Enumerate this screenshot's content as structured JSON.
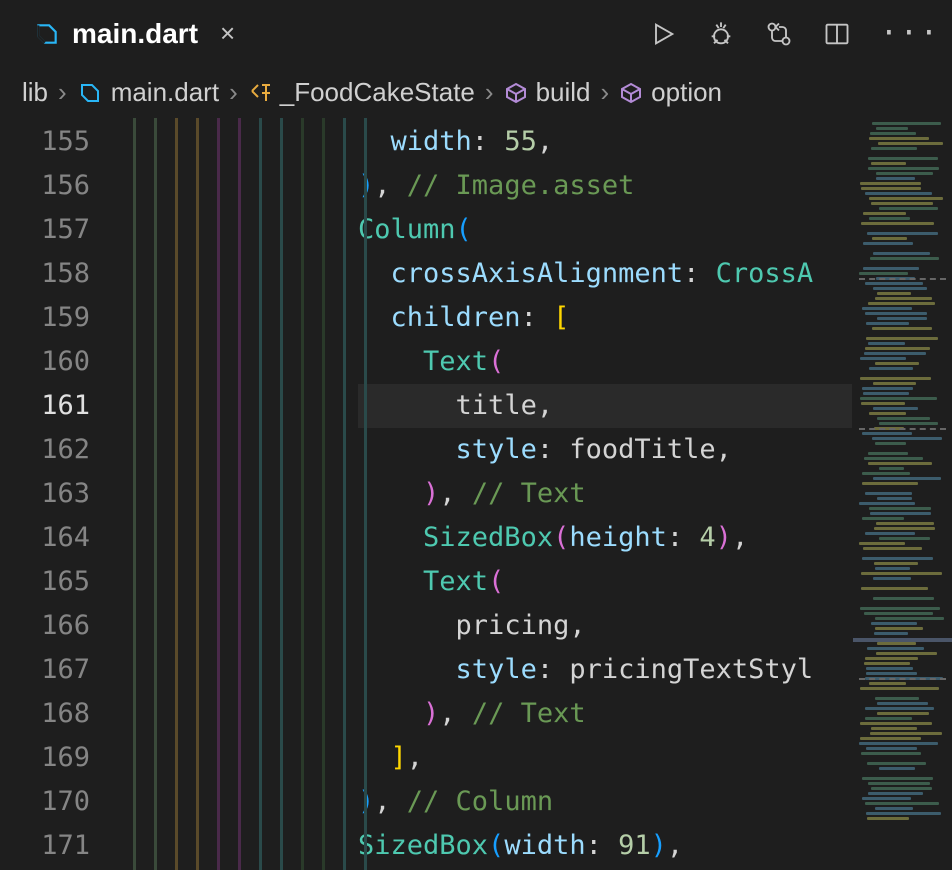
{
  "tab": {
    "filename": "main.dart",
    "close_glyph": "×"
  },
  "actions": {
    "run": "run-icon",
    "debug": "debug-icon",
    "git": "git-compare-icon",
    "split": "split-editor-icon",
    "more": "···"
  },
  "breadcrumbs": {
    "items": [
      {
        "label": "lib",
        "icon": null
      },
      {
        "label": "main.dart",
        "icon": "dart"
      },
      {
        "label": "_FoodCakeState",
        "icon": "class"
      },
      {
        "label": "build",
        "icon": "cube"
      },
      {
        "label": "option",
        "icon": "cube"
      }
    ],
    "separator": "›"
  },
  "gutter": {
    "start": 155,
    "active": 161,
    "lines": [
      155,
      156,
      157,
      158,
      159,
      160,
      161,
      162,
      163,
      164,
      165,
      166,
      167,
      168,
      169,
      170,
      171
    ]
  },
  "code": {
    "lines": [
      [
        {
          "t": "  ",
          "c": "plain"
        },
        {
          "t": "width",
          "c": "prop"
        },
        {
          "t": ": ",
          "c": "plain"
        },
        {
          "t": "55",
          "c": "num"
        },
        {
          "t": ",",
          "c": "plain"
        }
      ],
      [
        {
          "t": ")",
          "c": "paren3"
        },
        {
          "t": ", ",
          "c": "plain"
        },
        {
          "t": "// Image.asset",
          "c": "comment"
        }
      ],
      [
        {
          "t": "Column",
          "c": "kw-type"
        },
        {
          "t": "(",
          "c": "paren3"
        }
      ],
      [
        {
          "t": "  ",
          "c": "plain"
        },
        {
          "t": "crossAxisAlignment",
          "c": "prop"
        },
        {
          "t": ": ",
          "c": "plain"
        },
        {
          "t": "CrossA",
          "c": "kw-type"
        }
      ],
      [
        {
          "t": "  ",
          "c": "plain"
        },
        {
          "t": "children",
          "c": "prop"
        },
        {
          "t": ": ",
          "c": "plain"
        },
        {
          "t": "[",
          "c": "paren"
        }
      ],
      [
        {
          "t": "    ",
          "c": "plain"
        },
        {
          "t": "Text",
          "c": "kw-type"
        },
        {
          "t": "(",
          "c": "paren2"
        }
      ],
      [
        {
          "t": "      ",
          "c": "plain"
        },
        {
          "t": "title",
          "c": "ident"
        },
        {
          "t": ",",
          "c": "plain"
        }
      ],
      [
        {
          "t": "      ",
          "c": "plain"
        },
        {
          "t": "style",
          "c": "prop"
        },
        {
          "t": ": ",
          "c": "plain"
        },
        {
          "t": "foodTitle",
          "c": "ident"
        },
        {
          "t": ",",
          "c": "plain"
        }
      ],
      [
        {
          "t": "    ",
          "c": "plain"
        },
        {
          "t": ")",
          "c": "paren2"
        },
        {
          "t": ", ",
          "c": "plain"
        },
        {
          "t": "// Text",
          "c": "comment"
        }
      ],
      [
        {
          "t": "    ",
          "c": "plain"
        },
        {
          "t": "SizedBox",
          "c": "kw-type"
        },
        {
          "t": "(",
          "c": "paren2"
        },
        {
          "t": "height",
          "c": "prop"
        },
        {
          "t": ": ",
          "c": "plain"
        },
        {
          "t": "4",
          "c": "num"
        },
        {
          "t": ")",
          "c": "paren2"
        },
        {
          "t": ",",
          "c": "plain"
        }
      ],
      [
        {
          "t": "    ",
          "c": "plain"
        },
        {
          "t": "Text",
          "c": "kw-type"
        },
        {
          "t": "(",
          "c": "paren2"
        }
      ],
      [
        {
          "t": "      ",
          "c": "plain"
        },
        {
          "t": "pricing",
          "c": "ident"
        },
        {
          "t": ",",
          "c": "plain"
        }
      ],
      [
        {
          "t": "      ",
          "c": "plain"
        },
        {
          "t": "style",
          "c": "prop"
        },
        {
          "t": ": ",
          "c": "plain"
        },
        {
          "t": "pricingTextStyl",
          "c": "ident"
        }
      ],
      [
        {
          "t": "    ",
          "c": "plain"
        },
        {
          "t": ")",
          "c": "paren2"
        },
        {
          "t": ", ",
          "c": "plain"
        },
        {
          "t": "// Text",
          "c": "comment"
        }
      ],
      [
        {
          "t": "  ",
          "c": "plain"
        },
        {
          "t": "]",
          "c": "paren"
        },
        {
          "t": ",",
          "c": "plain"
        }
      ],
      [
        {
          "t": ")",
          "c": "paren3"
        },
        {
          "t": ", ",
          "c": "plain"
        },
        {
          "t": "// Column",
          "c": "comment"
        }
      ],
      [
        {
          "t": "SizedBox",
          "c": "kw-type"
        },
        {
          "t": "(",
          "c": "paren3"
        },
        {
          "t": "width",
          "c": "prop"
        },
        {
          "t": ": ",
          "c": "plain"
        },
        {
          "t": "91",
          "c": "num"
        },
        {
          "t": ")",
          "c": "paren3"
        },
        {
          "t": ",",
          "c": "plain"
        }
      ]
    ],
    "line_offsets": [
      2,
      0,
      0,
      0,
      0,
      0,
      0,
      0,
      0,
      0,
      0,
      0,
      0,
      0,
      0,
      0,
      0
    ]
  }
}
